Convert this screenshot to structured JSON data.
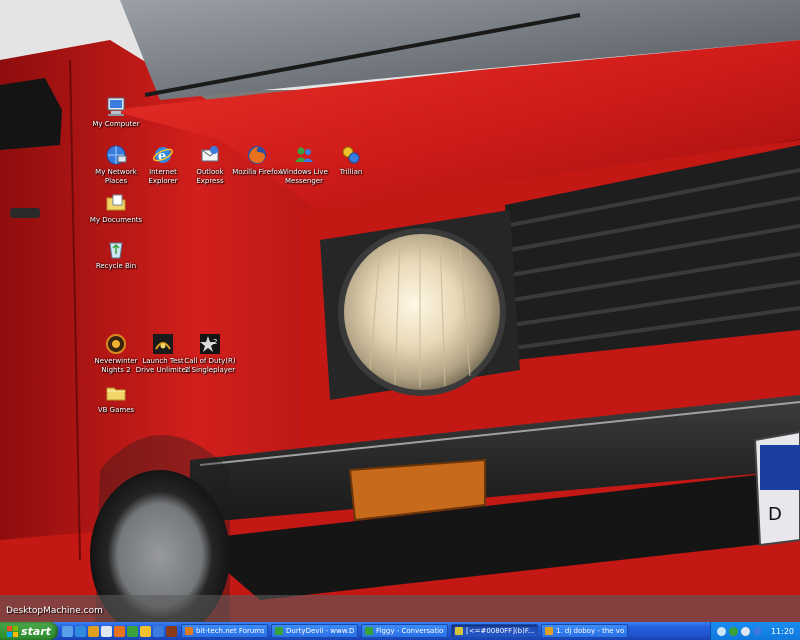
{
  "desktop": {
    "icons": [
      {
        "label": "My Computer",
        "glyph": "computer-icon"
      },
      {
        "label": "My Network\nPlaces",
        "glyph": "network-places-icon"
      },
      {
        "label": "Internet\nExplorer",
        "glyph": "internet-explorer-icon"
      },
      {
        "label": "Outlook\nExpress",
        "glyph": "outlook-express-icon"
      },
      {
        "label": "Mozilla Firefox",
        "glyph": "firefox-icon"
      },
      {
        "label": "Windows Live\nMessenger",
        "glyph": "messenger-icon"
      },
      {
        "label": "Trillian",
        "glyph": "trillian-icon"
      },
      {
        "label": "My Documents",
        "glyph": "folder-documents-icon"
      },
      {
        "label": "Recycle Bin",
        "glyph": "recycle-bin-icon"
      },
      {
        "label": "Neverwinter\nNights 2",
        "glyph": "neverwinter-icon"
      },
      {
        "label": "Launch Test\nDrive Unlimited",
        "glyph": "test-drive-icon"
      },
      {
        "label": "Call of Duty(R)\n2 Singleplayer",
        "glyph": "call-of-duty-icon"
      },
      {
        "label": "VB Games",
        "glyph": "folder-icon"
      }
    ],
    "watermark": "DesktopMachine.com"
  },
  "taskbar": {
    "start_label": "start",
    "tasks": [
      {
        "label": "bit-tech.net Forums -...",
        "icon_color": "#e07a1f"
      },
      {
        "label": "DurtyDevil - www.Da...",
        "icon_color": "#3aa23a"
      },
      {
        "label": "Figgy - Conversation",
        "icon_color": "#3aa23a"
      },
      {
        "label": "[<=#0080FF](b)F...",
        "icon_color": "#d8c43a"
      },
      {
        "label": "1. dj doboy - the voc...",
        "icon_color": "#e0a01f"
      }
    ],
    "clock": "11:20"
  },
  "colors": {
    "taskbar_blue": "#245edb",
    "start_green": "#3a9a3a",
    "car_red": "#d91c1c",
    "tray_blue": "#0f78dc"
  }
}
